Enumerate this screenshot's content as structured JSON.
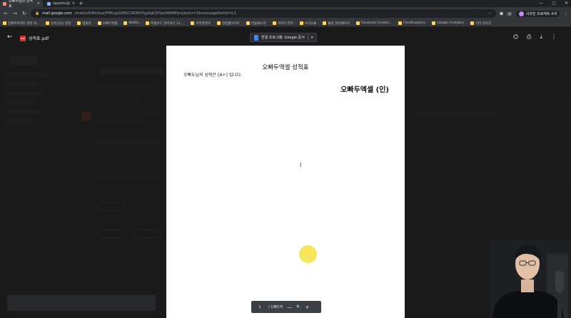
{
  "browser": {
    "tabs": [
      {
        "label": "오빠두님의 성적표"
      },
      {
        "label": "oppadu@"
      }
    ],
    "new_tab": "+",
    "window_controls": [
      "—",
      "▢",
      "✕"
    ],
    "url_host": "mail.google.com",
    "url_path": "/mail/u/0/#inbox/FMfcgzGtMSCDKRVhFjg5qKZVVacNWMPprojector=1&messagePartId=0.1",
    "profile_label": "사과진 프로젝트 4개",
    "bookmarks": [
      "전체프로젝트 관리 대...",
      "강의/공식 일정",
      "템플릿",
      "오빠두엑셀",
      "Netflix",
      "엑셀코드 관리하기 11 ...",
      "아마존관리",
      "관련웹사이트",
      "만들예시이",
      "가르다 관리",
      "수식오류",
      "불린 관리페이지",
      "Facebook Creator...",
      "FeedAnalytics",
      "Google Analytics",
      "기타 북마크"
    ]
  },
  "viewer": {
    "file_name": "성적표.pdf",
    "pdf_badge": "PDF",
    "open_with_label": "연결 프로그램: Google 문서",
    "open_with_caret": "▾",
    "back_arrow": "←",
    "tool_icons": [
      "add-to-drive-icon",
      "print-icon",
      "download-icon",
      "more-icon"
    ]
  },
  "pdf": {
    "title": "오빠두엑셀 성적표",
    "body": "오빠두님의 성적은 [A+] 입니다.",
    "signature": "오빠두엑셀 (인)"
  },
  "pager": {
    "page_number": "1",
    "page_total": "/ 1페이지",
    "zoom_out": "—",
    "zoom_in": "+"
  },
  "colors": {
    "accent_yellow": "#f5e34a",
    "pdf_red": "#d93025",
    "docs_blue": "#4285f4"
  }
}
